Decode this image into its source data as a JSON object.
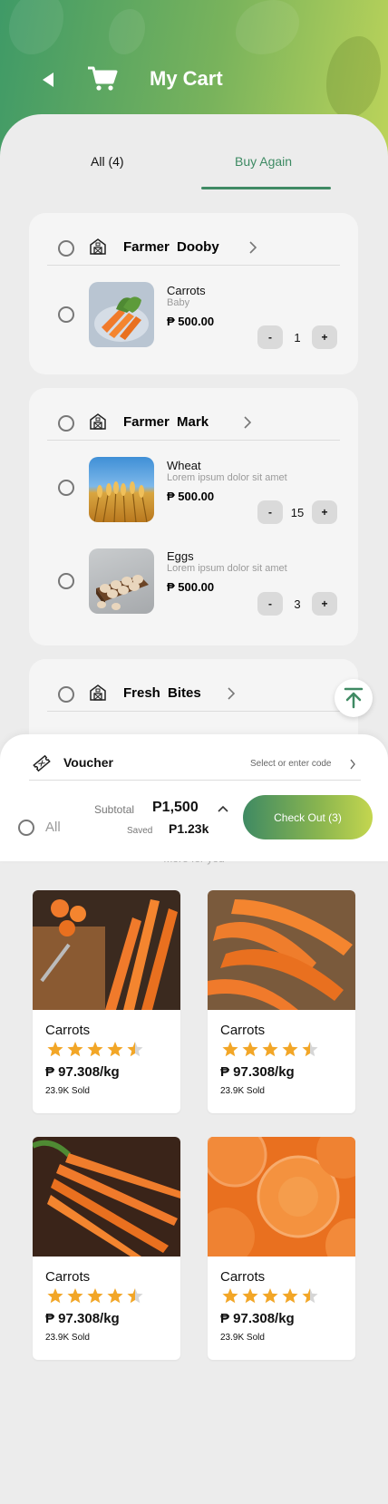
{
  "header": {
    "title": "My Cart"
  },
  "tabs": [
    {
      "label": "All (4)"
    },
    {
      "label": "Buy Again"
    }
  ],
  "farms": [
    {
      "name": "Farmer  Dooby",
      "products": [
        {
          "name": "Carrots",
          "desc": "Baby",
          "price": "₱ 500.00",
          "qty": "1"
        }
      ]
    },
    {
      "name": "Farmer  Mark",
      "products": [
        {
          "name": "Wheat",
          "desc": "Lorem ipsum dolor sit amet",
          "price": "₱ 500.00",
          "qty": "15"
        },
        {
          "name": "Eggs",
          "desc": "Lorem ipsum dolor sit amet",
          "price": "₱ 500.00",
          "qty": "3"
        }
      ]
    },
    {
      "name": "Fresh Bites",
      "products": []
    }
  ],
  "stepper": {
    "minus": "-",
    "plus": "+"
  },
  "voucher": {
    "label": "Voucher",
    "hint": "Select or enter code"
  },
  "summary": {
    "all_label": "All",
    "subtotal_label": "Subtotal",
    "subtotal": "P1,500",
    "saved_label": "Saved",
    "saved": "P1.23k",
    "checkout": "Check Out (3)"
  },
  "more_label": "More for you",
  "recommendations": [
    {
      "name": "Carrots",
      "price": "₱ 97.308/kg",
      "sold": "23.9K Sold",
      "rating": 4.5
    },
    {
      "name": "Carrots",
      "price": "₱ 97.308/kg",
      "sold": "23.9K Sold",
      "rating": 4.5
    },
    {
      "name": "Carrots",
      "price": "₱ 97.308/kg",
      "sold": "23.9K Sold",
      "rating": 4.5
    },
    {
      "name": "Carrots",
      "price": "₱ 97.308/kg",
      "sold": "23.9K Sold",
      "rating": 4.5
    }
  ],
  "colors": {
    "brand_green": "#3f8a63",
    "accent_lime": "#c4d64f",
    "star": "#f2a627"
  }
}
